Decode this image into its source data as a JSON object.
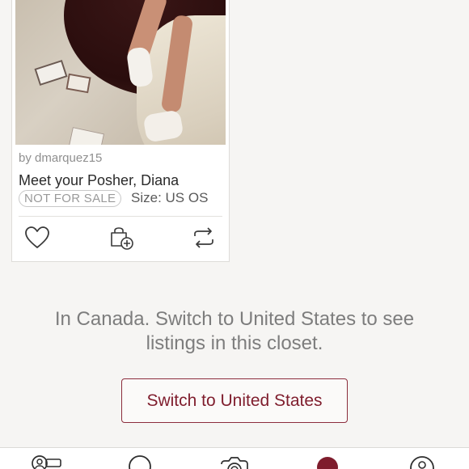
{
  "listing": {
    "by_line": "by dmarquez15",
    "title": "Meet your Posher, Diana",
    "badge": "NOT FOR SALE",
    "size": "Size: US OS"
  },
  "actions": {
    "like_icon": "heart-icon",
    "bundle_icon": "bag-plus-icon",
    "share_icon": "share-arrows-icon"
  },
  "notice": {
    "text": "In Canada. Switch to United States to see listings in this closet."
  },
  "switch_button": {
    "label": "Switch to United States"
  },
  "tabbar": {
    "tabs": [
      {
        "icon": "person-key-icon"
      },
      {
        "icon": "search-circle-icon"
      },
      {
        "icon": "camera-icon"
      },
      {
        "icon": "shop-dot-icon"
      },
      {
        "icon": "profile-icon"
      }
    ]
  },
  "colors": {
    "brand": "#7f1d2d",
    "background": "#f6f5f3",
    "muted_text": "#7d7d7d"
  }
}
